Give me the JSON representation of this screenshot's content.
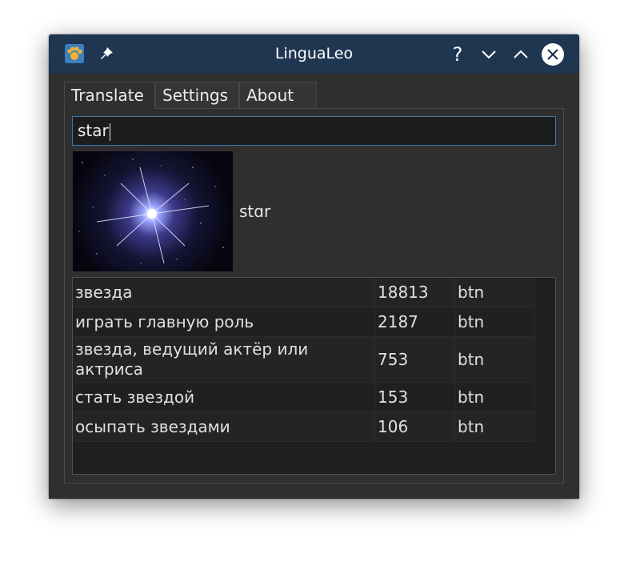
{
  "window": {
    "title": "LinguaLeo"
  },
  "titlebar": {
    "help_label": "?",
    "icons": [
      "lingualeo-app-icon",
      "pin-icon",
      "help-icon",
      "minimize-icon",
      "maximize-icon",
      "close-icon"
    ]
  },
  "tabs": [
    {
      "label": "Translate",
      "active": true
    },
    {
      "label": "Settings",
      "active": false
    },
    {
      "label": "About",
      "active": false
    }
  ],
  "search": {
    "value": "star"
  },
  "result": {
    "word": "stɑr",
    "image": "star-image"
  },
  "translations": [
    {
      "text": "звезда",
      "count": "18813",
      "button": "btn"
    },
    {
      "text": "играть главную роль",
      "count": "2187",
      "button": "btn"
    },
    {
      "text": "звезда, ведущий актёр или актриса",
      "count": "753",
      "button": "btn"
    },
    {
      "text": "стать звездой",
      "count": "153",
      "button": "btn"
    },
    {
      "text": "осыпать звездами",
      "count": "106",
      "button": "btn"
    }
  ],
  "colors": {
    "titlebar": "#1f3651",
    "window": "#2f2f2f",
    "input_border": "#3b79ad",
    "table_bg": "#1f1f1f"
  }
}
